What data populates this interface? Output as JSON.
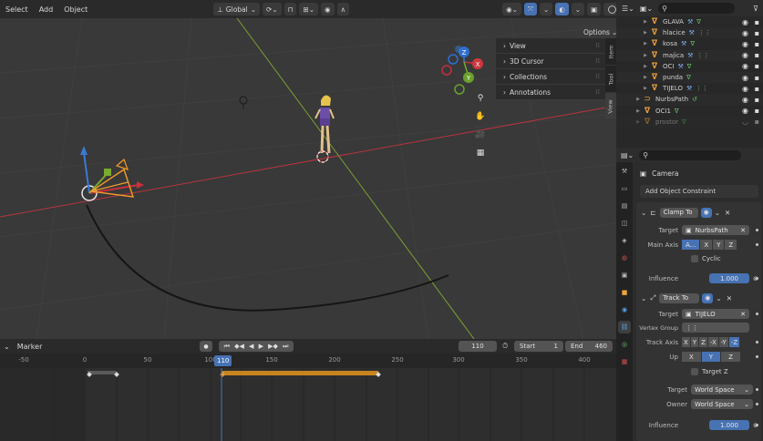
{
  "viewport_header": {
    "menus": [
      "Select",
      "Add",
      "Object"
    ],
    "orientation": "Global",
    "options_label": "Options"
  },
  "npanel": {
    "rows": [
      "View",
      "3D Cursor",
      "Collections",
      "Annotations"
    ],
    "tabs": [
      "Item",
      "Tool",
      "View"
    ]
  },
  "timeline": {
    "marker_label": "Marker",
    "current_frame": "110",
    "start_label": "Start",
    "start_value": "1",
    "end_label": "End",
    "end_value": "460",
    "playhead_label": "110",
    "ruler_ticks": [
      "-50",
      "0",
      "50",
      "100",
      "150",
      "200",
      "250",
      "300",
      "350",
      "400"
    ]
  },
  "outliner": {
    "items": [
      {
        "name": "GLAVA",
        "type": "mesh"
      },
      {
        "name": "hlacice",
        "type": "mesh"
      },
      {
        "name": "kosa",
        "type": "mesh"
      },
      {
        "name": "majica",
        "type": "mesh"
      },
      {
        "name": "OCI",
        "type": "mesh"
      },
      {
        "name": "punda",
        "type": "mesh"
      },
      {
        "name": "TIJELO",
        "type": "mesh"
      },
      {
        "name": "NurbsPath",
        "type": "curve"
      },
      {
        "name": "OCI1",
        "type": "mesh"
      },
      {
        "name": "prostor",
        "type": "mesh"
      }
    ]
  },
  "properties": {
    "object_name": "Camera",
    "add_constraint_label": "Add Object Constraint",
    "clamp": {
      "title": "Clamp To",
      "target_label": "Target",
      "target_value": "NurbsPath",
      "main_axis_label": "Main Axis",
      "axes": [
        "A...",
        "X",
        "Y",
        "Z"
      ],
      "cyclic_label": "Cyclic",
      "influence_label": "Influence",
      "influence_value": "1.000"
    },
    "track": {
      "title": "Track To",
      "target_label": "Target",
      "target_value": "TIJELO",
      "vertex_group_label": "Vertex Group",
      "track_axis_label": "Track Axis",
      "track_axes": [
        "X",
        "Y",
        "Z",
        "-X",
        "-Y",
        "-Z"
      ],
      "up_label": "Up",
      "up_axes": [
        "X",
        "Y",
        "Z"
      ],
      "target_z_label": "Target Z",
      "target_space_label": "Target",
      "target_space_value": "World Space",
      "owner_label": "Owner",
      "owner_value": "World Space",
      "influence_label": "Influence",
      "influence_value": "1.000"
    }
  },
  "colors": {
    "accent_blue": "#4772b3",
    "orange_mesh": "#f0a33d",
    "x_axis": "#c0303f",
    "y_axis": "#7ea83a",
    "keyframe_bar": "#c7851f"
  }
}
